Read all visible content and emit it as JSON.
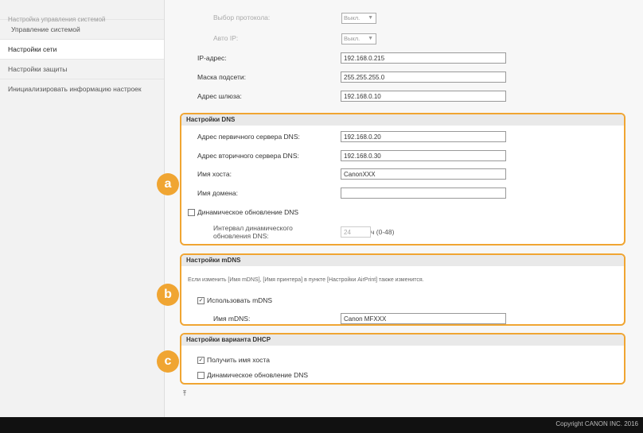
{
  "sidebar": {
    "header": "Настройка управления системой",
    "items": [
      {
        "label": "Управление системой"
      },
      {
        "label": "Настройки сети"
      },
      {
        "label": "Настройки защиты"
      },
      {
        "label": "Инициализировать информацию настроек"
      }
    ]
  },
  "top": {
    "protocol_label": "Выбор протокола:",
    "protocol_value": "Выкл.",
    "autoip_label": "Авто IP:",
    "autoip_value": "Выкл.",
    "ip_label": "IP-адрес:",
    "ip_value": "192.168.0.215",
    "mask_label": "Маска подсети:",
    "mask_value": "255.255.255.0",
    "gateway_label": "Адрес шлюза:",
    "gateway_value": "192.168.0.10"
  },
  "dns": {
    "title": "Настройки DNS",
    "primary_label": "Адрес первичного сервера DNS:",
    "primary_value": "192.168.0.20",
    "secondary_label": "Адрес вторичного сервера DNS:",
    "secondary_value": "192.168.0.30",
    "host_label": "Имя хоста:",
    "host_value": "CanonXXX",
    "domain_label": "Имя домена:",
    "domain_value": "",
    "dyn_label": "Динамическое обновление DNS",
    "interval_label_1": "Интервал динамического",
    "interval_label_2": "обновления DNS:",
    "interval_value": "24",
    "interval_unit": "ч (0-48)",
    "badge": "a"
  },
  "mdns": {
    "title": "Настройки mDNS",
    "note": "Если изменить [Имя mDNS], [Имя принтера] в пункте [Настройки AirPrint] также изменится.",
    "use_label": "Использовать mDNS",
    "name_label": "Имя mDNS:",
    "name_value": "Canon MFXXX",
    "badge": "b"
  },
  "dhcp": {
    "title": "Настройки варианта DHCP",
    "gethost_label": "Получить имя хоста",
    "dyn_label": "Динамическое обновление DNS",
    "badge": "c"
  },
  "checks": {
    "checked": "✓"
  },
  "nav": {
    "top_icon": "scroll-to-top-icon",
    "top_glyph": "⤒"
  },
  "footer": {
    "copyright": "Copyright CANON INC. 2016"
  },
  "colors": {
    "accent": "#f0a532"
  }
}
